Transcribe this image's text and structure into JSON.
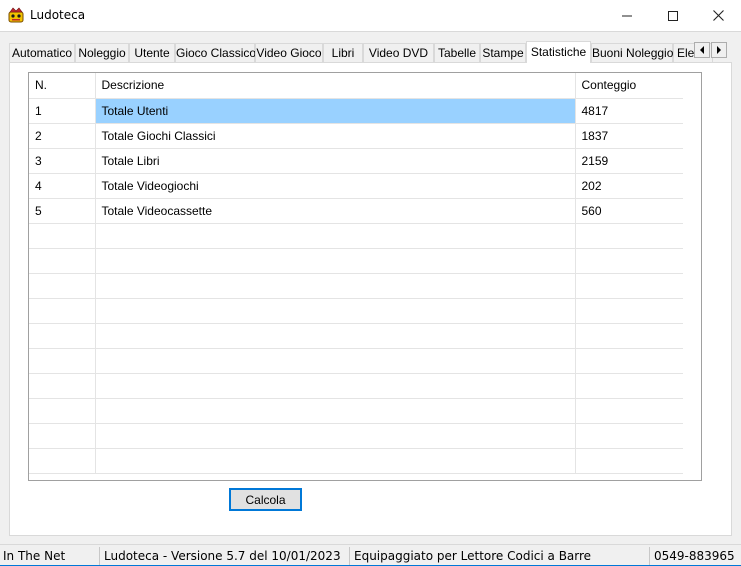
{
  "window": {
    "title": "Ludoteca",
    "icon": "ludoteca-app-icon",
    "controls": {
      "minimize": "minimize-icon",
      "maximize": "maximize-icon",
      "close": "close-icon"
    }
  },
  "tabs": [
    {
      "label": "Automatico"
    },
    {
      "label": "Noleggio"
    },
    {
      "label": "Utente"
    },
    {
      "label": "Gioco Classico"
    },
    {
      "label": "Video Gioco"
    },
    {
      "label": "Libri"
    },
    {
      "label": "Video DVD"
    },
    {
      "label": "Tabelle"
    },
    {
      "label": "Stampe"
    },
    {
      "label": "Statistiche",
      "active": true
    },
    {
      "label": "Buoni Noleggio"
    },
    {
      "label": "Elen"
    }
  ],
  "grid": {
    "columns": [
      "N.",
      "Descrizione",
      "Conteggio"
    ],
    "rows": [
      {
        "n": "1",
        "descrizione": "Totale Utenti",
        "conteggio": "4817",
        "selected": true
      },
      {
        "n": "2",
        "descrizione": "Totale Giochi Classici",
        "conteggio": "1837"
      },
      {
        "n": "3",
        "descrizione": "Totale Libri",
        "conteggio": "2159"
      },
      {
        "n": "4",
        "descrizione": "Totale Videogiochi",
        "conteggio": "202"
      },
      {
        "n": "5",
        "descrizione": "Totale Videocassette",
        "conteggio": "560"
      }
    ],
    "empty_rows": 10,
    "selection_color": "#99d1ff"
  },
  "actions": {
    "calcola_label": "Calcola"
  },
  "statusbar": {
    "company": "In The Net",
    "version": "Ludoteca - Versione 5.7 del 10/01/2023",
    "feature": "Equipaggiato per Lettore Codici a Barre",
    "phone": "0549-883965"
  },
  "colors": {
    "accent": "#0078d7",
    "background": "#f0f0f0"
  }
}
